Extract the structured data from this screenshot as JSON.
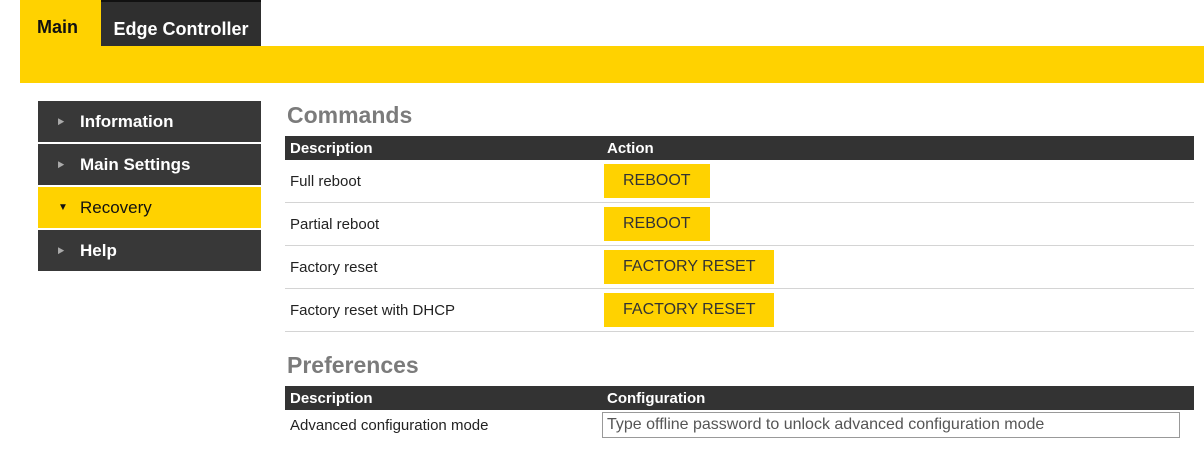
{
  "tabs": [
    {
      "label": "Main",
      "active": true
    },
    {
      "label": "Edge Controller",
      "active": false
    }
  ],
  "sidebar": {
    "items": [
      {
        "label": "Information",
        "expanded": false
      },
      {
        "label": "Main Settings",
        "expanded": false
      },
      {
        "label": "Recovery",
        "expanded": true
      },
      {
        "label": "Help",
        "expanded": false
      }
    ]
  },
  "commands": {
    "title": "Commands",
    "headers": [
      "Description",
      "Action"
    ],
    "rows": [
      {
        "description": "Full reboot",
        "action": "REBOOT"
      },
      {
        "description": "Partial reboot",
        "action": "REBOOT"
      },
      {
        "description": "Factory reset",
        "action": "FACTORY RESET"
      },
      {
        "description": "Factory reset with DHCP",
        "action": "FACTORY RESET"
      }
    ]
  },
  "preferences": {
    "title": "Preferences",
    "headers": [
      "Description",
      "Configuration"
    ],
    "rows": [
      {
        "description": "Advanced configuration mode",
        "value": "",
        "placeholder": "Type offline password to unlock advanced configuration mode"
      }
    ]
  },
  "colors": {
    "accent": "#ffd200",
    "dark": "#333333",
    "section_title": "#7b7b7b"
  }
}
